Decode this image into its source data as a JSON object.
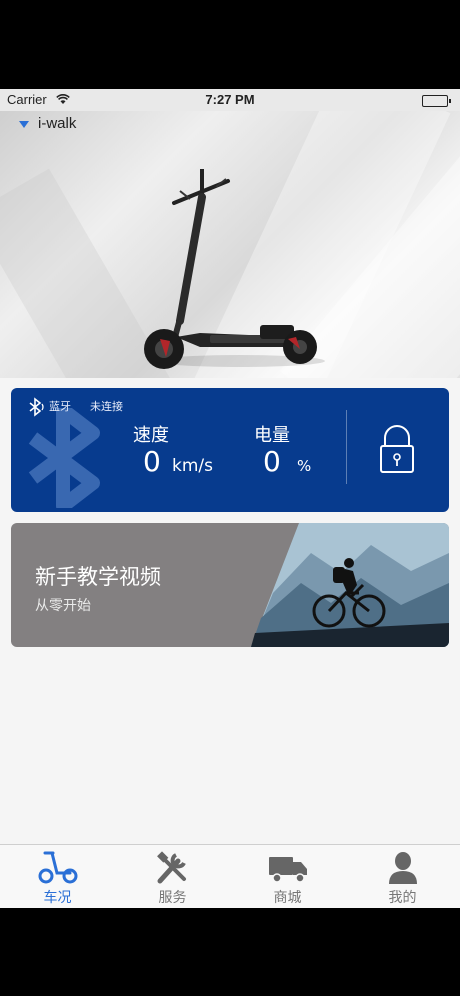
{
  "status_bar": {
    "carrier": "Carrier",
    "time": "7:27 PM"
  },
  "device": {
    "name": "i-walk"
  },
  "bluetooth_card": {
    "bt_label": "蓝牙",
    "bt_status": "未连接",
    "speed_label": "速度",
    "speed_value": "0",
    "speed_unit": "km/s",
    "battery_label": "电量",
    "battery_value": "0",
    "battery_unit": "%"
  },
  "tutorial_card": {
    "title": "新手教学视频",
    "subtitle": "从零开始"
  },
  "tab_bar": {
    "tabs": [
      {
        "label": "车况",
        "icon": "scooter-icon",
        "active": true
      },
      {
        "label": "服务",
        "icon": "tools-icon",
        "active": false
      },
      {
        "label": "商城",
        "icon": "truck-icon",
        "active": false
      },
      {
        "label": "我的",
        "icon": "user-icon",
        "active": false
      }
    ]
  },
  "colors": {
    "accent": "#2a6fd6",
    "card_blue": "#073b8e",
    "card_gray": "#838081"
  }
}
